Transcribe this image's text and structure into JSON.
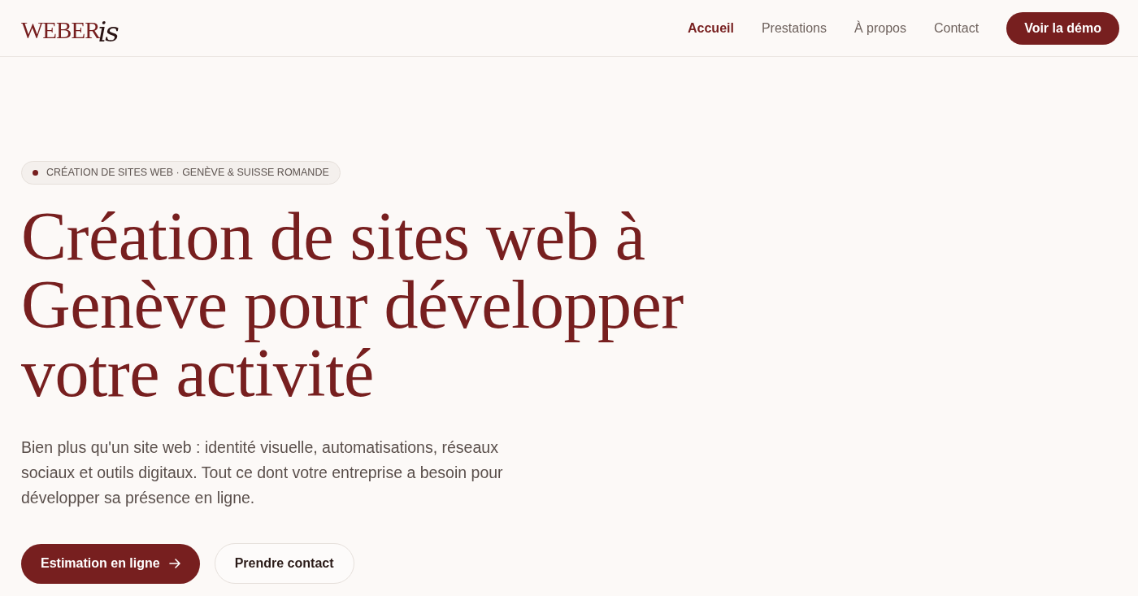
{
  "header": {
    "logo": {
      "main": "WEBER",
      "script": "is"
    },
    "nav": [
      {
        "label": "Accueil",
        "selected": true
      },
      {
        "label": "Prestations",
        "selected": false
      },
      {
        "label": "À propos",
        "selected": false
      },
      {
        "label": "Contact",
        "selected": false
      }
    ],
    "cta": "Voir la démo"
  },
  "hero": {
    "badge": "CRÉATION DE SITES WEB · GENÈVE & SUISSE ROMANDE",
    "title": "Création de sites web à Genève pour développer votre activité",
    "lead": "Bien plus qu'un site web : identité visuelle, automatisations, réseaux sociaux et outils digitaux. Tout ce dont votre entreprise a besoin pour développer sa présence en ligne.",
    "buttons": [
      {
        "label": "Estimation en ligne",
        "kind": "primary"
      },
      {
        "label": "Prendre contact",
        "kind": "secondary"
      }
    ]
  }
}
